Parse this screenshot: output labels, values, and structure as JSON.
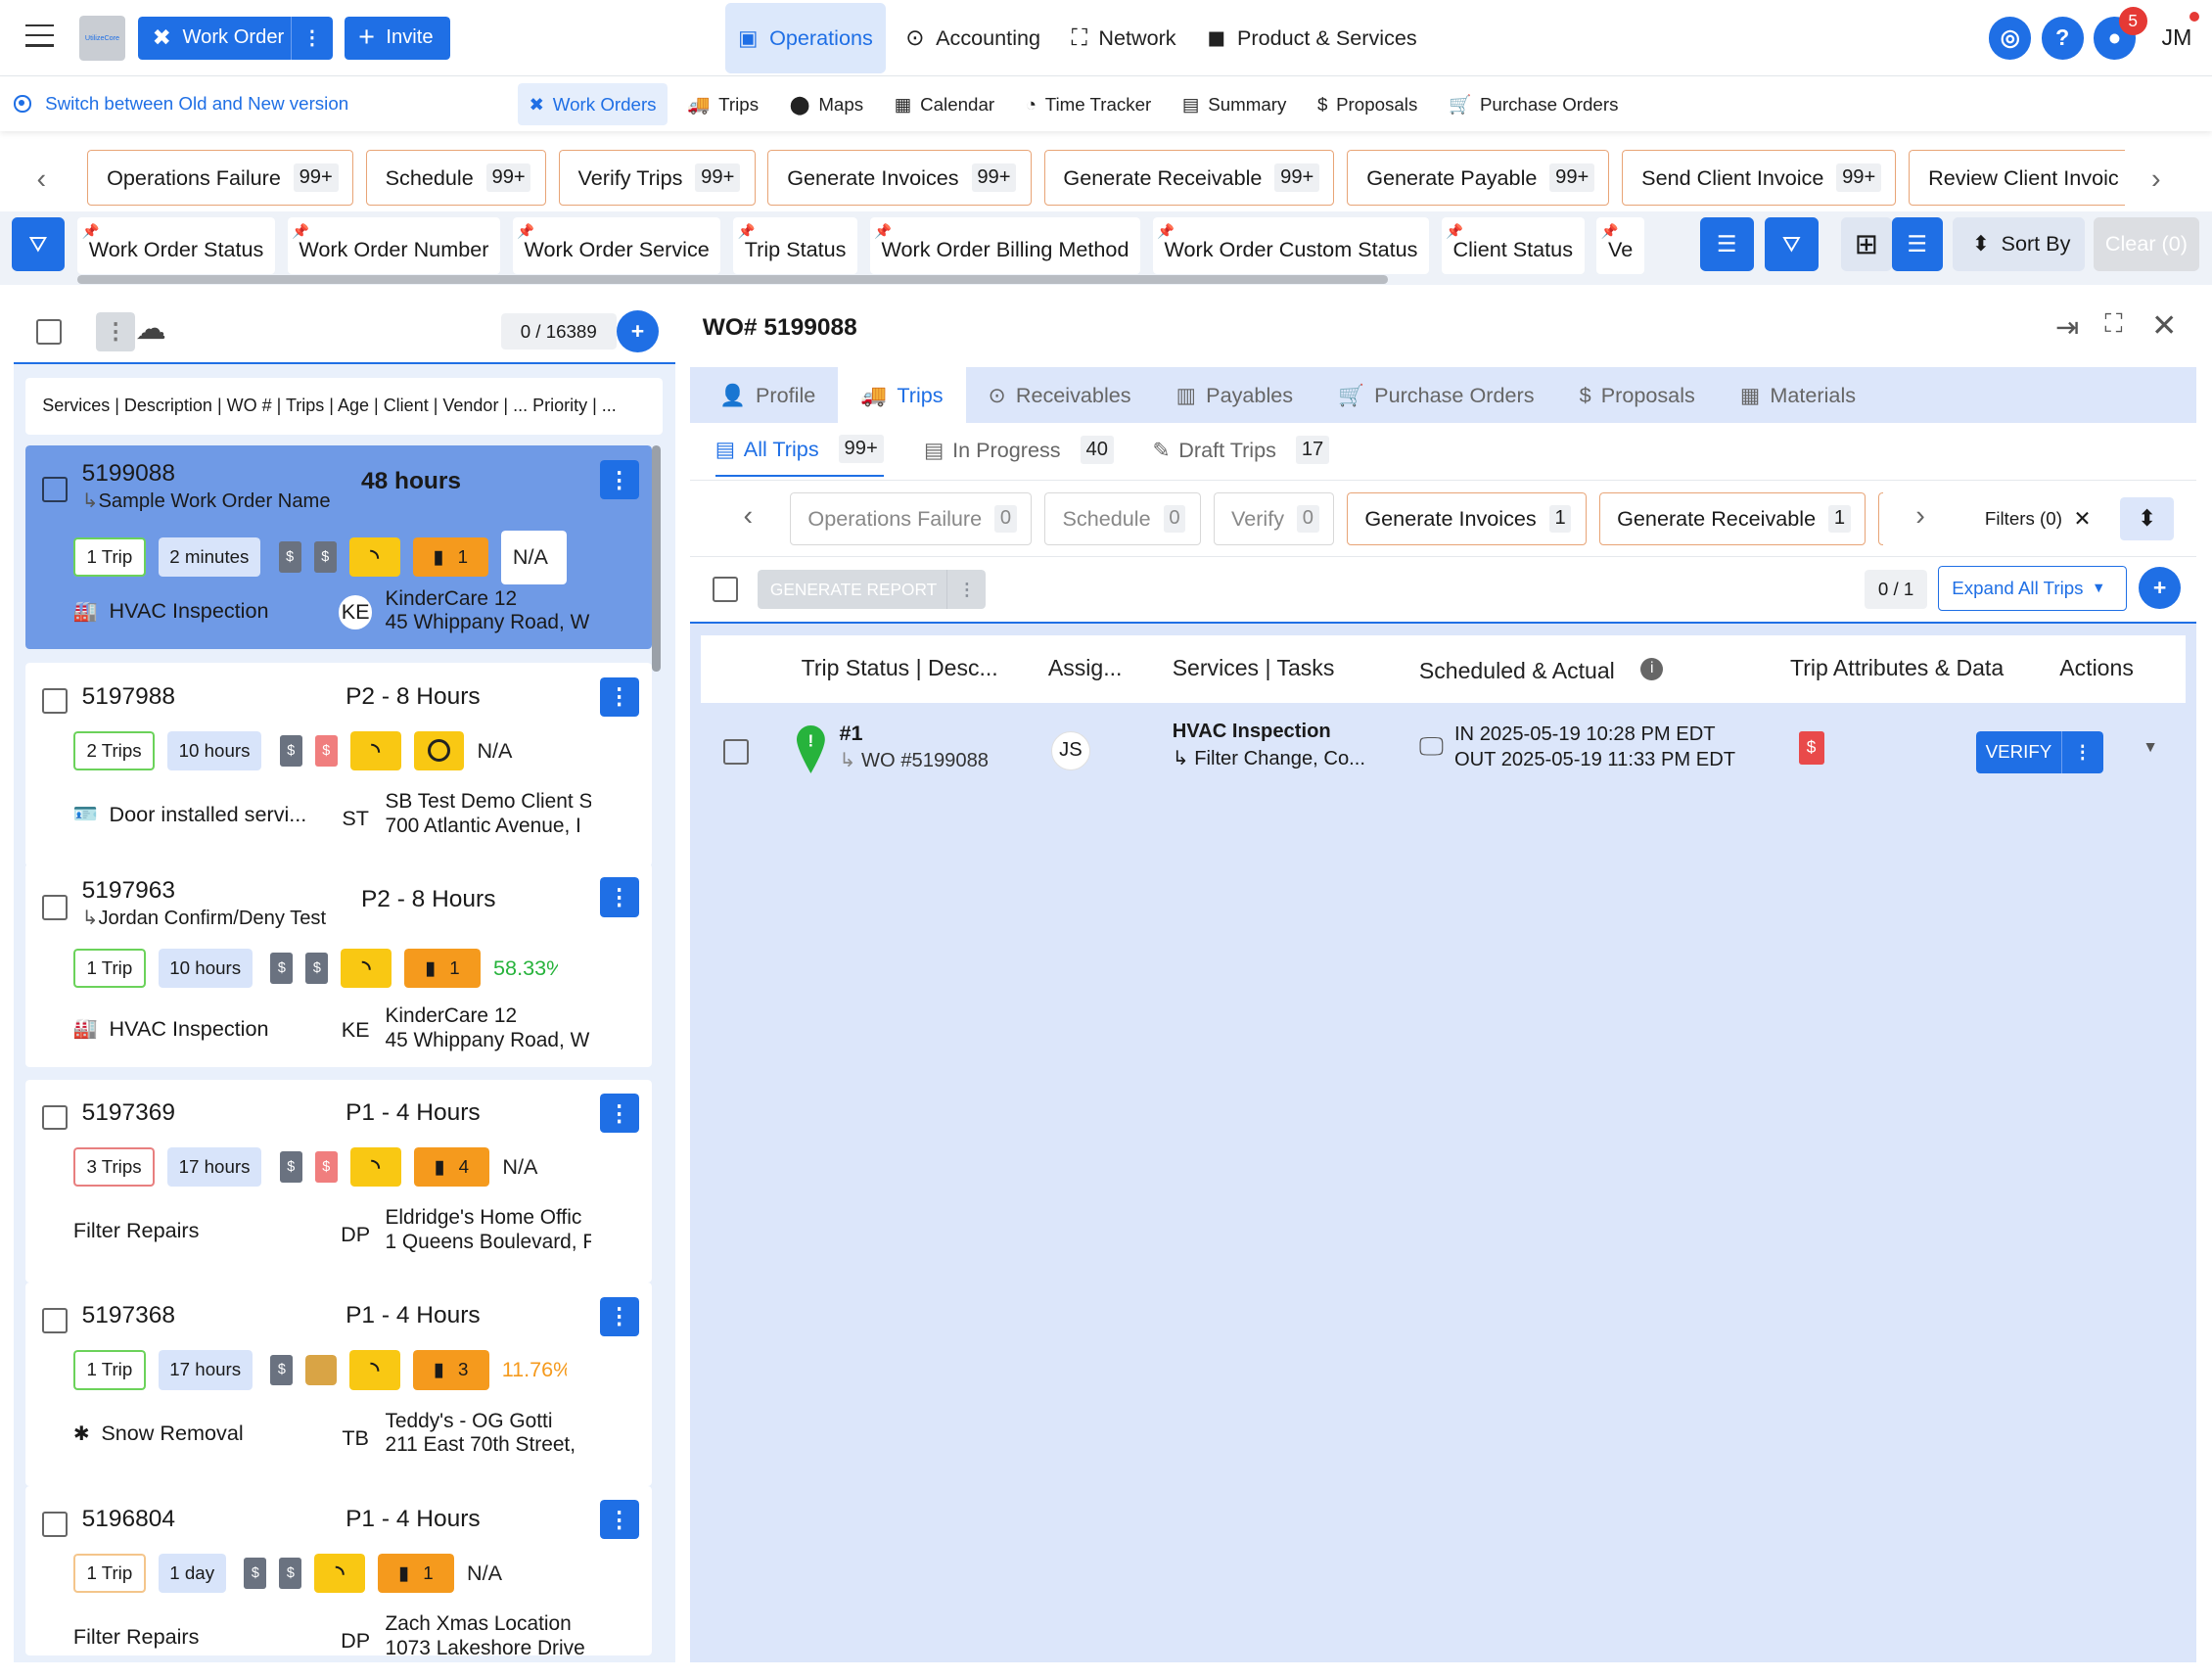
{
  "app": {
    "logo_text": "UtilizeCore"
  },
  "top": {
    "work_order_btn": "Work Order",
    "invite_btn": "Invite",
    "nav": [
      {
        "label": "Operations"
      },
      {
        "label": "Accounting"
      },
      {
        "label": "Network"
      },
      {
        "label": "Product & Services"
      }
    ],
    "help": "?",
    "chat_badge": "5",
    "user_initials": "JM"
  },
  "sub": {
    "switch_text": "Switch between Old and New version",
    "tabs": [
      "Work Orders",
      "Trips",
      "Maps",
      "Calendar",
      "Time Tracker",
      "Summary",
      "Proposals",
      "Purchase Orders"
    ]
  },
  "status_chips": [
    {
      "label": "Operations Failure",
      "count": "99+"
    },
    {
      "label": "Schedule",
      "count": "99+"
    },
    {
      "label": "Verify Trips",
      "count": "99+"
    },
    {
      "label": "Generate Invoices",
      "count": "99+"
    },
    {
      "label": "Generate Receivable",
      "count": "99+"
    },
    {
      "label": "Generate Payable",
      "count": "99+"
    },
    {
      "label": "Send Client Invoice",
      "count": "99+"
    },
    {
      "label": "Review Client Invoic",
      "count": ""
    }
  ],
  "filter_chips": [
    "Work Order Status",
    "Work Order Number",
    "Work Order Service",
    "Trip Status",
    "Work Order Billing Method",
    "Work Order Custom Status",
    "Client Status",
    "Ve"
  ],
  "sort_by": "Sort By",
  "clear": "Clear (0)",
  "list": {
    "count": "0 / 16389",
    "column_summary": "Services | Description | WO # | Trips | Age | Client | Vendor | ...   Priority | ...",
    "cards": [
      {
        "wo": "5199088",
        "sub": "Sample Work Order Name",
        "priority": "48 hours",
        "trips": "1 Trip",
        "age": "2 minutes",
        "org": "1",
        "metric": "N/A",
        "service": "HVAC Inspection",
        "init": "KE",
        "client": "KinderCare 12",
        "address": "45 Whippany Road, W"
      },
      {
        "wo": "5197988",
        "sub": "",
        "priority": "P2 - 8 Hours",
        "trips": "2 Trips",
        "age": "10 hours",
        "org": "",
        "metric": "N/A",
        "service": "Door installed servi...",
        "init": "ST",
        "client": "SB Test Demo Client S",
        "address": "700 Atlantic Avenue, I"
      },
      {
        "wo": "5197963",
        "sub": "Jordan Confirm/Deny Test",
        "priority": "P2 - 8 Hours",
        "trips": "1 Trip",
        "age": "10 hours",
        "org": "1",
        "metric": "58.33%",
        "service": "HVAC Inspection",
        "init": "KE",
        "client": "KinderCare 12",
        "address": "45 Whippany Road, W"
      },
      {
        "wo": "5197369",
        "sub": "",
        "priority": "P1 - 4 Hours",
        "trips": "3 Trips",
        "age": "17 hours",
        "org": "4",
        "metric": "N/A",
        "service": "Filter Repairs",
        "init": "DP",
        "client": "Eldridge's Home Offic",
        "address": "1 Queens Boulevard, F"
      },
      {
        "wo": "5197368",
        "sub": "",
        "priority": "P1 - 4 Hours",
        "trips": "1 Trip",
        "age": "17 hours",
        "org": "3",
        "metric": "11.76%",
        "service": "Snow Removal",
        "init": "TB",
        "client": "Teddy's - OG Gotti",
        "address": "211 East 70th Street,"
      },
      {
        "wo": "5196804",
        "sub": "",
        "priority": "P1 - 4 Hours",
        "trips": "1 Trip",
        "age": "1 day",
        "org": "1",
        "metric": "N/A",
        "service": "Filter Repairs",
        "init": "DP",
        "client": "Zach Xmas Location",
        "address": "1073 Lakeshore Drive"
      }
    ]
  },
  "detail": {
    "title": "WO# 5199088",
    "tabs": [
      "Profile",
      "Trips",
      "Receivables",
      "Payables",
      "Purchase Orders",
      "Proposals",
      "Materials"
    ],
    "subtabs": [
      {
        "label": "All Trips",
        "count": "99+"
      },
      {
        "label": "In Progress",
        "count": "40"
      },
      {
        "label": "Draft Trips",
        "count": "17"
      }
    ],
    "wf_chips": [
      {
        "label": "Operations Failure",
        "count": "0"
      },
      {
        "label": "Schedule",
        "count": "0"
      },
      {
        "label": "Verify",
        "count": "0"
      },
      {
        "label": "Generate Invoices",
        "count": "1"
      },
      {
        "label": "Generate Receivable",
        "count": "1"
      }
    ],
    "filters": "Filters (0)",
    "generate_report": "GENERATE REPORT",
    "trip_count": "0 / 1",
    "expand": "Expand All Trips",
    "columns": [
      "Trip Status | Desc...",
      "Assig...",
      "Services | Tasks",
      "Scheduled & Actual",
      "Trip Attributes & Data",
      "Actions"
    ],
    "trip": {
      "num": "#1",
      "wo": "WO #5199088",
      "assignee": "JS",
      "service": "HVAC Inspection",
      "tasks": "Filter Change, Co...",
      "in": "IN 2025-05-19 10:28 PM EDT",
      "out": "OUT 2025-05-19 11:33 PM EDT",
      "action": "VERIFY"
    }
  },
  "colors": {
    "primary": "#1f6fe5",
    "panel": "#dce6fa",
    "chip_border": "#e8a476"
  }
}
